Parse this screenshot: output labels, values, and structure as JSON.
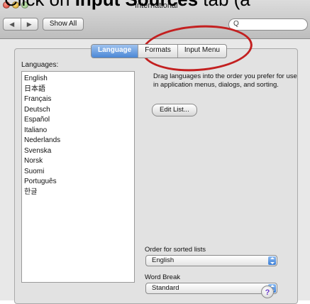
{
  "caption": {
    "pre": "Click on ",
    "bold": "Input Sources",
    "post": " tab (a"
  },
  "window": {
    "title": "International",
    "nav_back": "◀",
    "nav_forward": "▶",
    "show_all": "Show All",
    "search": {
      "icon": "search-icon",
      "glyph": "Q",
      "placeholder": ""
    }
  },
  "tabs": [
    {
      "label": "Language",
      "active": true
    },
    {
      "label": "Formats",
      "active": false
    },
    {
      "label": "Input Menu",
      "active": false
    }
  ],
  "languages_label": "Languages:",
  "languages": [
    "English",
    "日本語",
    "Français",
    "Deutsch",
    "Español",
    "Italiano",
    "Nederlands",
    "Svenska",
    "Norsk",
    "Suomi",
    "Português",
    "한글"
  ],
  "description": "Drag languages into the order you prefer for use in application menus, dialogs, and sorting.",
  "edit_list": "Edit List...",
  "sorted_lists": {
    "label": "Order for sorted lists",
    "value": "English"
  },
  "word_break": {
    "label": "Word Break",
    "value": "Standard"
  },
  "help_glyph": "?",
  "colors": {
    "annotation": "#c32020",
    "selected_tab": "#4b87d6"
  }
}
